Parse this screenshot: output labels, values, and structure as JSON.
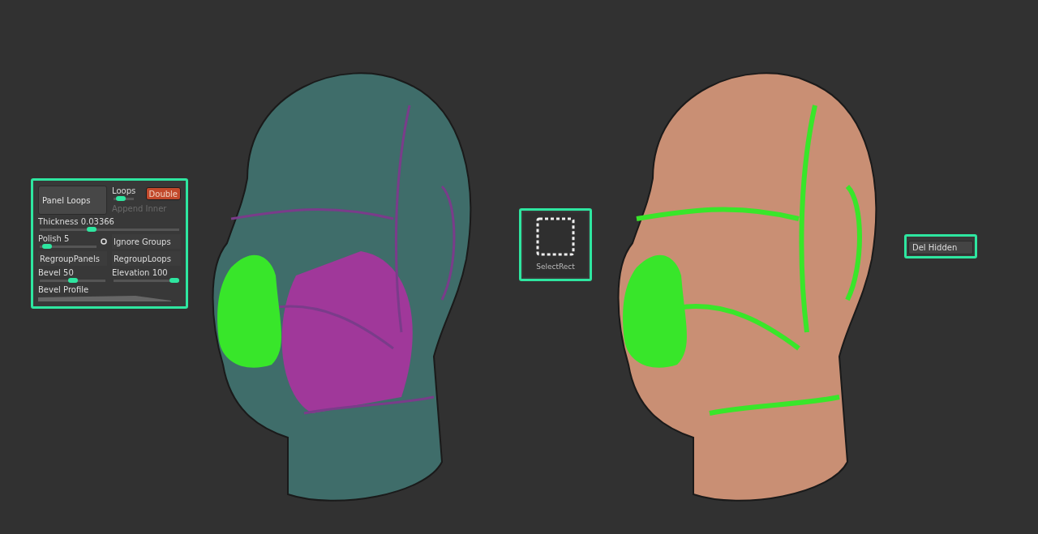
{
  "loops_panel": {
    "title": "Panel Loops",
    "loops": {
      "label": "Loops",
      "level": 0.22
    },
    "double": {
      "label": "Double",
      "on": true
    },
    "append_inner": {
      "label": "Append Inner",
      "disabled": true
    },
    "thickness": {
      "label": "Thickness",
      "value": "0.03366",
      "level": 0.36
    },
    "polish": {
      "label": "Polish",
      "value": "5",
      "level": 0.05
    },
    "ignore_groups": {
      "label": "Ignore Groups"
    },
    "regroup_panels": {
      "label": "RegroupPanels"
    },
    "regroup_loops": {
      "label": "RegroupLoops"
    },
    "bevel": {
      "label": "Bevel",
      "value": "50",
      "level": 0.5
    },
    "elevation": {
      "label": "Elevation",
      "value": "100",
      "level": 1
    },
    "bevel_profile": {
      "label": "Bevel Profile"
    }
  },
  "select_tool": {
    "label": "SelectRect"
  },
  "del_hidden": {
    "label": "Del Hidden"
  }
}
